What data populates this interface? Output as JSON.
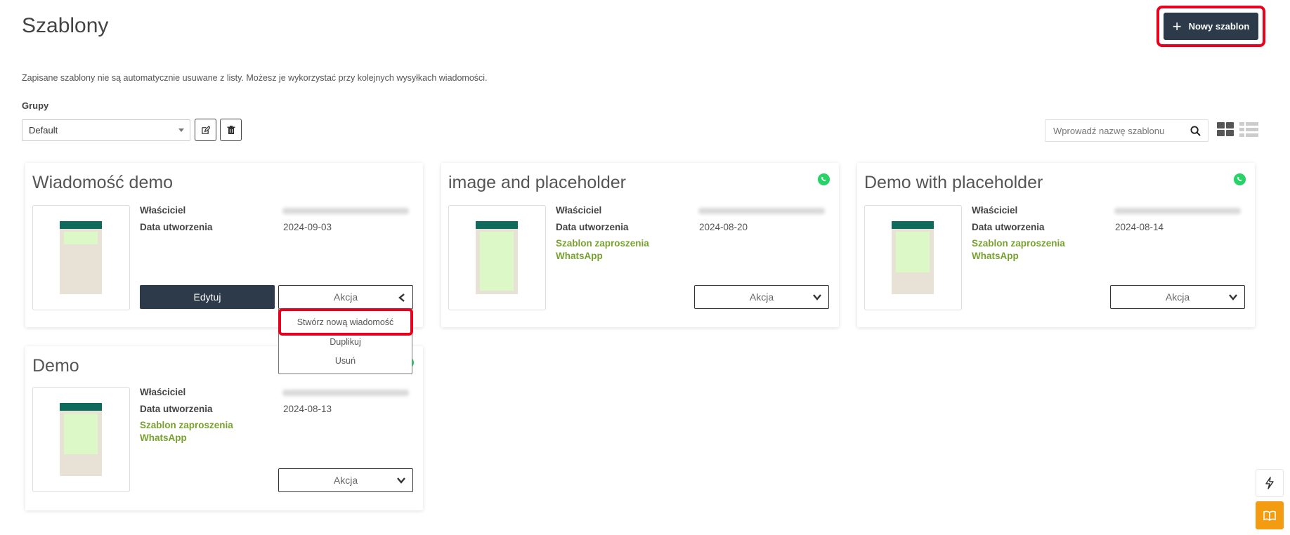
{
  "page": {
    "title": "Szablony",
    "new_button_label": "Nowy szablon",
    "info": "Zapisane szablony nie są automatycznie usuwane z listy. Możesz je wykorzystać przy kolejnych wysyłkach wiadomości."
  },
  "groups": {
    "label": "Grupy",
    "selected": "Default"
  },
  "search": {
    "placeholder": "Wprowadź nazwę szablonu"
  },
  "labels": {
    "owner": "Właściciel",
    "created": "Data utworzenia",
    "edit": "Edytuj",
    "action": "Akcja"
  },
  "cards": [
    {
      "title": "Wiadomość demo",
      "created": "2024-09-03",
      "link1": "",
      "link2": "",
      "whatsapp": false
    },
    {
      "title": "image and placeholder",
      "created": "2024-08-20",
      "link1": "Szablon zaproszenia",
      "link2": "WhatsApp",
      "whatsapp": true
    },
    {
      "title": "Demo with placeholder",
      "created": "2024-08-14",
      "link1": "Szablon zaproszenia",
      "link2": "WhatsApp",
      "whatsapp": true
    },
    {
      "title": "Demo",
      "created": "2024-08-13",
      "link1": "Szablon zaproszenia",
      "link2": "WhatsApp",
      "whatsapp": true
    }
  ],
  "action_menu": {
    "items": [
      "Stwórz nową wiadomość",
      "Duplikuj",
      "Usuń"
    ]
  },
  "colors": {
    "primary_dark": "#2c3a4a",
    "accent_green": "#78a22f",
    "whatsapp_green": "#25d366",
    "highlight_red": "#e8001c",
    "side_orange": "#f39c12"
  },
  "icons": {
    "new": "plus-icon",
    "edit_group": "edit-icon",
    "delete_group": "trash-icon",
    "search": "search-icon",
    "grid_view": "grid-view-icon",
    "list_view": "list-view-icon",
    "whatsapp": "whatsapp-icon",
    "side_top": "lightning-icon",
    "side_bottom": "book-icon"
  }
}
